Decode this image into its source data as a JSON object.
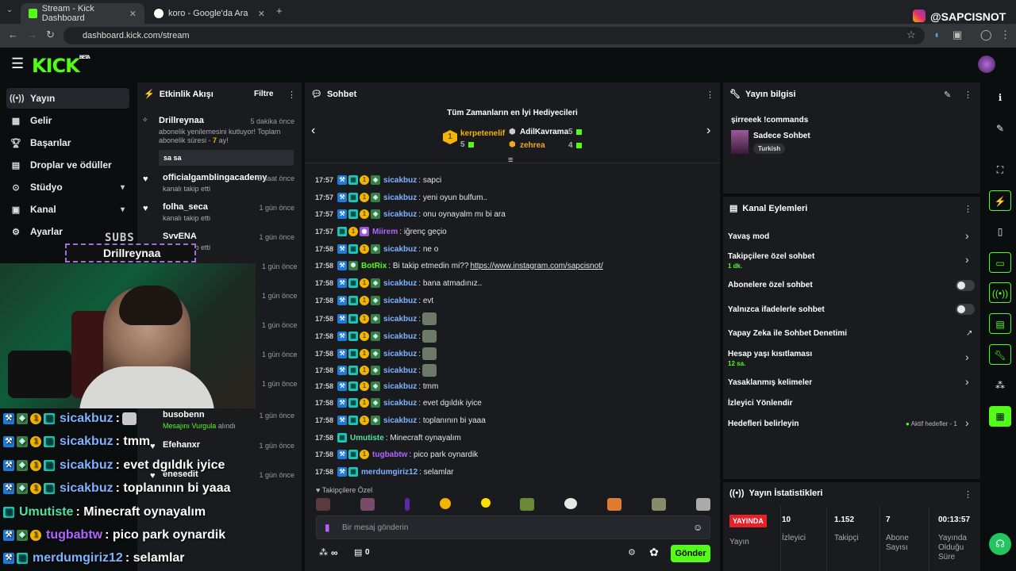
{
  "browser": {
    "tabs": [
      {
        "label": "Stream - Kick Dashboard",
        "active": true
      },
      {
        "label": "koro - Google'da Ara",
        "active": false
      }
    ],
    "url": "dashboard.kick.com/stream",
    "watermark": "@SAPCISNOT"
  },
  "header": {
    "logo": "KICK",
    "beta": "BETA"
  },
  "nav": {
    "items": [
      {
        "label": "Yayın",
        "icon": "broadcast-icon"
      },
      {
        "label": "Gelir",
        "icon": "wallet-icon"
      },
      {
        "label": "Başarılar",
        "icon": "trophy-icon"
      },
      {
        "label": "Droplar ve ödüller",
        "icon": "gift-icon"
      },
      {
        "label": "Stüdyo",
        "icon": "studio-icon"
      },
      {
        "label": "Kanal",
        "icon": "channel-icon"
      },
      {
        "label": "Ayarlar",
        "icon": "gear-icon"
      }
    ]
  },
  "activity": {
    "title": "Etkinlik Akışı",
    "filter": "Filtre",
    "events": [
      {
        "name": "Drillreynaa",
        "time": "5 dakika önce",
        "text": "abonelik yenilemesini kutluyor! Toplam abonelik süresi - ",
        "highlight": "7",
        "text_end": " ay!",
        "message": "sa sa"
      },
      {
        "name": "officialgamblingacademy",
        "time": "3 saat önce",
        "text": "kanalı takip etti"
      },
      {
        "name": "folha_seca",
        "time": "1 gün önce",
        "text": "kanalı takip etti"
      },
      {
        "name": "SvvENA",
        "time": "1 gün önce",
        "text": "kanalı takip etti"
      },
      {
        "time": "1 gün önce"
      },
      {
        "time": "1 gün önce"
      },
      {
        "time": "1 gün önce"
      },
      {
        "time": "1 gün önce"
      },
      {
        "time": "1 gün önce"
      },
      {
        "name": "busobenn",
        "time": "1 gün önce",
        "text": "Mesajını Vurgula",
        "text_end": " alındı"
      },
      {
        "name": "Efehanxr",
        "time": "1 gün önce"
      },
      {
        "name": "enesedit",
        "time": "1 gün önce"
      }
    ]
  },
  "overlay": {
    "sub_label": "SUBS",
    "sub_name": "Drillreynaa",
    "chat": [
      {
        "user": "sicakbuz",
        "msg": " : ",
        "color": "#7fb2ff",
        "badges": [
          "blue",
          "green",
          "gold",
          "teal"
        ],
        "emote": true
      },
      {
        "user": "sicakbuz",
        "msg": " : tmm",
        "color": "#7fb2ff",
        "badges": [
          "blue",
          "green",
          "gold",
          "teal"
        ]
      },
      {
        "user": "sicakbuz",
        "msg": " : evet dgıldık iyice",
        "color": "#7fb2ff",
        "badges": [
          "blue",
          "green",
          "gold",
          "teal"
        ]
      },
      {
        "user": "sicakbuz",
        "msg": " : toplanının bi yaaa",
        "color": "#7fb2ff",
        "badges": [
          "blue",
          "green",
          "gold",
          "teal"
        ]
      },
      {
        "user": "Umutiste",
        "msg": " : Minecraft oynayalım",
        "color": "#53e0a0",
        "badges": [
          "teal"
        ]
      },
      {
        "user": "tugbabtw",
        "msg": " : pico park oynardik",
        "color": "#b066ff",
        "badges": [
          "blue",
          "green",
          "gold"
        ]
      },
      {
        "user": "merdumgiriz12",
        "msg": " : selamlar ",
        "color": "#7fb2ff",
        "badges": [
          "blue",
          "teal"
        ]
      }
    ]
  },
  "chat": {
    "title": "Sohbet",
    "gifters_title": "Tüm Zamanların en İyi Hediyecileri",
    "gifters": [
      {
        "rank": "1",
        "name": "kerpetenelif",
        "count": "5",
        "color": "#f5b400"
      },
      {
        "name": "AdilKavrama",
        "count": "5",
        "color": "#ffffff"
      },
      {
        "name": "zehrea",
        "count": "4",
        "color": "#f5a623"
      }
    ],
    "messages": [
      {
        "time": "17:57",
        "user": "sicakbuz",
        "text": ": sapci",
        "color": "#7fb2ff",
        "badges": [
          "blue",
          "teal",
          "gold",
          "green"
        ]
      },
      {
        "time": "17:57",
        "user": "sicakbuz",
        "text": ": yeni oyun bulfum..",
        "color": "#7fb2ff",
        "badges": [
          "blue",
          "teal",
          "gold",
          "green"
        ]
      },
      {
        "time": "17:57",
        "user": "sicakbuz",
        "text": ": onu oynayalm mı bi ara",
        "color": "#7fb2ff",
        "badges": [
          "blue",
          "teal",
          "gold",
          "green"
        ]
      },
      {
        "time": "17:57",
        "user": "Miirem",
        "text": ": iğrenç geçio",
        "color": "#b066ff",
        "badges": [
          "teal",
          "gold",
          "purple"
        ]
      },
      {
        "time": "17:58",
        "user": "sicakbuz",
        "text": ": ne o",
        "color": "#7fb2ff",
        "badges": [
          "blue",
          "teal",
          "gold",
          "green"
        ]
      },
      {
        "time": "17:58",
        "user": "BotRix",
        "text": ": Bi takip etmedin mi?? ",
        "link": "https://www.instagram.com/sapcisnot/",
        "color": "#53fc18",
        "badges": [
          "blue",
          "greenbot"
        ]
      },
      {
        "time": "17:58",
        "user": "sicakbuz",
        "text": ": bana atmadınız..",
        "color": "#7fb2ff",
        "badges": [
          "blue",
          "teal",
          "gold",
          "green"
        ]
      },
      {
        "time": "17:58",
        "user": "sicakbuz",
        "text": ": evt",
        "color": "#7fb2ff",
        "badges": [
          "blue",
          "teal",
          "gold",
          "green"
        ]
      },
      {
        "time": "17:58",
        "user": "sicakbuz",
        "text": ": ",
        "color": "#7fb2ff",
        "badges": [
          "blue",
          "teal",
          "gold",
          "green"
        ],
        "emote": true
      },
      {
        "time": "17:58",
        "user": "sicakbuz",
        "text": ": ",
        "color": "#7fb2ff",
        "badges": [
          "blue",
          "teal",
          "gold",
          "green"
        ],
        "emote": true
      },
      {
        "time": "17:58",
        "user": "sicakbuz",
        "text": ": ",
        "color": "#7fb2ff",
        "badges": [
          "blue",
          "teal",
          "gold",
          "green"
        ],
        "emote": true
      },
      {
        "time": "17:58",
        "user": "sicakbuz",
        "text": ": ",
        "color": "#7fb2ff",
        "badges": [
          "blue",
          "teal",
          "gold",
          "green"
        ],
        "emote": true
      },
      {
        "time": "17:58",
        "user": "sicakbuz",
        "text": ": tmm",
        "color": "#7fb2ff",
        "badges": [
          "blue",
          "teal",
          "gold",
          "green"
        ]
      },
      {
        "time": "17:58",
        "user": "sicakbuz",
        "text": ": evet dgıldık iyice",
        "color": "#7fb2ff",
        "badges": [
          "blue",
          "teal",
          "gold",
          "green"
        ]
      },
      {
        "time": "17:58",
        "user": "sicakbuz",
        "text": ": toplanının bi yaaa",
        "color": "#7fb2ff",
        "badges": [
          "blue",
          "teal",
          "gold",
          "green"
        ]
      },
      {
        "time": "17:58",
        "user": "Umutiste",
        "text": ": Minecraft oynayalım",
        "color": "#53e0a0",
        "badges": [
          "teal"
        ]
      },
      {
        "time": "17:58",
        "user": "tugbabtw",
        "text": ": pico park oynardik",
        "color": "#b066ff",
        "badges": [
          "blue",
          "teal",
          "gold"
        ]
      },
      {
        "time": "17:58",
        "user": "merdumgiriz12",
        "text": ": selamlar ",
        "color": "#7fb2ff",
        "badges": [
          "blue",
          "teal"
        ]
      }
    ],
    "followers_only": "Takipçilere Özel",
    "placeholder": "Bir mesaj gönderin",
    "points": "∞",
    "count": "0",
    "send": "Gönder"
  },
  "stream_info": {
    "title": "Yayın bilgisi",
    "stream_title": "şirreeek !commands",
    "category": "Sadece Sohbet",
    "language": "Turkish"
  },
  "actions": {
    "title": "Kanal Eylemleri",
    "items": [
      {
        "label": "Yavaş mod",
        "control": "arrow"
      },
      {
        "label": "Takipçilere özel sohbet",
        "sub": "1 dk.",
        "control": "arrow"
      },
      {
        "label": "Abonelere özel sohbet",
        "control": "toggle"
      },
      {
        "label": "Yalnızca ifadelerle sohbet",
        "control": "toggle"
      },
      {
        "label": "Yapay Zeka ile Sohbet Denetimi",
        "control": "external"
      },
      {
        "label": "Hesap yaşı kısıtlaması",
        "sub": "12 sa.",
        "control": "arrow"
      },
      {
        "label": "Yasaklanmış kelimeler",
        "control": "arrow"
      },
      {
        "label": "İzleyici Yönlendir",
        "control": "none"
      },
      {
        "label": "Hedefleri belirleyin",
        "extra": "Aktif hedefler - 1",
        "control": "arrow"
      }
    ]
  },
  "stats": {
    "title": "Yayın İstatistikleri",
    "live_badge": "YAYINDA",
    "live_label": "Yayın",
    "viewers": "10",
    "viewers_label": "İzleyici",
    "followers": "1.152",
    "followers_label": "Takipçi",
    "subs": "7",
    "subs_label1": "Abone",
    "subs_label2": "Sayısı",
    "uptime": "00:13:57",
    "uptime_label1": "Yayında",
    "uptime_label2": "Olduğu",
    "uptime_label3": "Süre"
  }
}
